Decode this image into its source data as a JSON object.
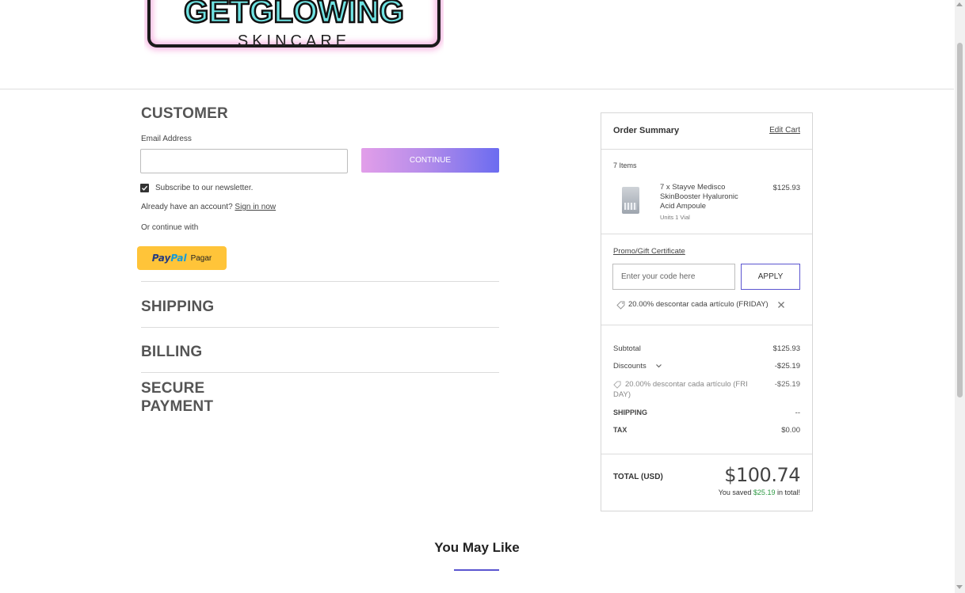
{
  "header": {
    "logo_line1": "GETGLOWING",
    "logo_line2": "SKINCARE"
  },
  "customer": {
    "heading": "CUSTOMER",
    "email_label": "Email Address",
    "email_value": "",
    "continue_label": "CONTINUE",
    "newsletter_label": "Subscribe to our newsletter.",
    "newsletter_checked": true,
    "account_prompt": "Already have an account?",
    "sign_in_link": "Sign in now",
    "or_continue": "Or continue with",
    "paypal": {
      "pay": "Pay",
      "pal": "Pal",
      "pagar": "Pagar"
    }
  },
  "sections": {
    "shipping": "SHIPPING",
    "billing": "BILLING",
    "secure_payment_line1": "SECURE",
    "secure_payment_line2": "PAYMENT"
  },
  "summary": {
    "title": "Order Summary",
    "edit_cart": "Edit Cart",
    "items_count": "7 Items",
    "item": {
      "name_line1": "7 x Stayve Medisco",
      "name_line2": "SkinBooster Hyaluronic",
      "name_line3": "Acid Ampoule",
      "units": "Units 1 Vial",
      "price": "$125.93"
    },
    "promo": {
      "label": "Promo/Gift Certificate",
      "placeholder": "Enter your code here",
      "apply_label": "APPLY",
      "applied_coupon": "20.00% descontar cada artículo (FRIDAY)"
    },
    "totals": {
      "subtotal_label": "Subtotal",
      "subtotal_value": "$125.93",
      "discounts_label": "Discounts",
      "discounts_value": "-$25.19",
      "coupon_line1": "20.00% descontar cada artículo (FRI",
      "coupon_line2": "DAY)",
      "coupon_value": "-$25.19",
      "shipping_label": "SHIPPING",
      "shipping_value": "--",
      "tax_label": "TAX",
      "tax_value": "$0.00"
    },
    "grand_total": {
      "label": "TOTAL (USD)",
      "value": "$100.74",
      "saved_prefix": "You saved",
      "saved_amount": "$25.19",
      "saved_suffix": "in total!"
    }
  },
  "recommendations": {
    "heading": "You May Like"
  },
  "colors": {
    "accent": "#5b55d0",
    "gradient_start": "#e29ee9",
    "gradient_end": "#6b6cf0",
    "paypal_yellow": "#ffc439",
    "saved_green": "#2e9a44"
  }
}
